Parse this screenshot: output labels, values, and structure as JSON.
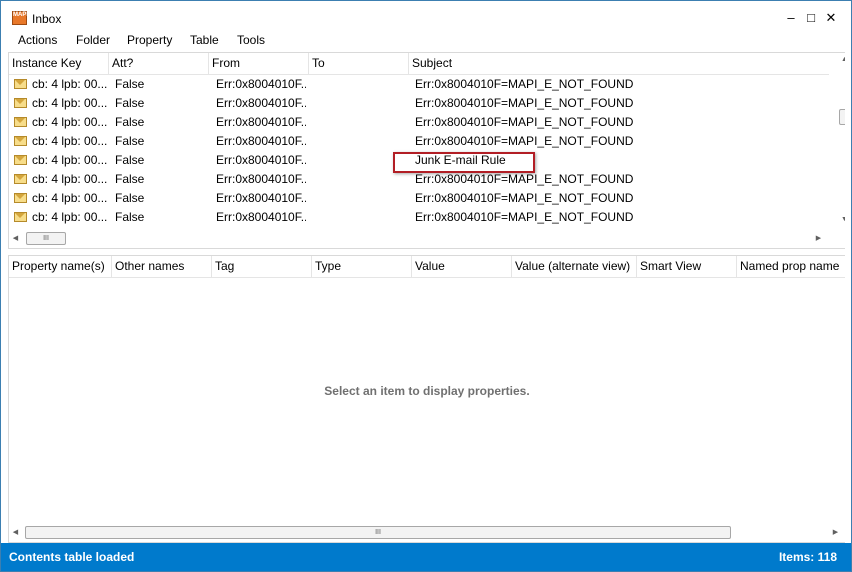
{
  "window": {
    "title": "Inbox",
    "app_icon": "mfcmapi-icon"
  },
  "window_controls": {
    "minimize": "–",
    "maximize": "□",
    "close": "✕"
  },
  "menu": [
    "Actions",
    "Folder",
    "Property",
    "Table",
    "Tools"
  ],
  "contents_table": {
    "columns": [
      "Instance Key",
      "Att?",
      "From",
      "To",
      "Subject"
    ],
    "rows": [
      {
        "instance_key": "cb: 4 lpb: 00...",
        "att": "False",
        "from": "Err:0x8004010F...",
        "to": "",
        "subject": "Err:0x8004010F=MAPI_E_NOT_FOUND"
      },
      {
        "instance_key": "cb: 4 lpb: 00...",
        "att": "False",
        "from": "Err:0x8004010F...",
        "to": "",
        "subject": "Err:0x8004010F=MAPI_E_NOT_FOUND"
      },
      {
        "instance_key": "cb: 4 lpb: 00...",
        "att": "False",
        "from": "Err:0x8004010F...",
        "to": "",
        "subject": "Err:0x8004010F=MAPI_E_NOT_FOUND"
      },
      {
        "instance_key": "cb: 4 lpb: 00...",
        "att": "False",
        "from": "Err:0x8004010F...",
        "to": "",
        "subject": "Err:0x8004010F=MAPI_E_NOT_FOUND"
      },
      {
        "instance_key": "cb: 4 lpb: 00...",
        "att": "False",
        "from": "Err:0x8004010F...",
        "to": "",
        "subject": "Junk E-mail Rule"
      },
      {
        "instance_key": "cb: 4 lpb: 00...",
        "att": "False",
        "from": "Err:0x8004010F...",
        "to": "",
        "subject": "Err:0x8004010F=MAPI_E_NOT_FOUND"
      },
      {
        "instance_key": "cb: 4 lpb: 00...",
        "att": "False",
        "from": "Err:0x8004010F...",
        "to": "",
        "subject": "Err:0x8004010F=MAPI_E_NOT_FOUND"
      },
      {
        "instance_key": "cb: 4 lpb: 00...",
        "att": "False",
        "from": "Err:0x8004010F...",
        "to": "",
        "subject": "Err:0x8004010F=MAPI_E_NOT_FOUND"
      }
    ],
    "row_icon": "envelope-icon"
  },
  "properties": {
    "columns": [
      "Property name(s)",
      "Other names",
      "Tag",
      "Type",
      "Value",
      "Value (alternate view)",
      "Smart View",
      "Named prop name"
    ],
    "placeholder": "Select an item to display properties."
  },
  "scrollbar": {
    "grip": "III",
    "up": "▲",
    "down": "▼",
    "left": "◀",
    "right": "▶"
  },
  "status": {
    "left": "Contents table loaded",
    "right": "Items: 118"
  },
  "colors": {
    "status_bar": "#007acc",
    "highlight_border": "#b21e25",
    "window_border": "#3c7fb1"
  }
}
